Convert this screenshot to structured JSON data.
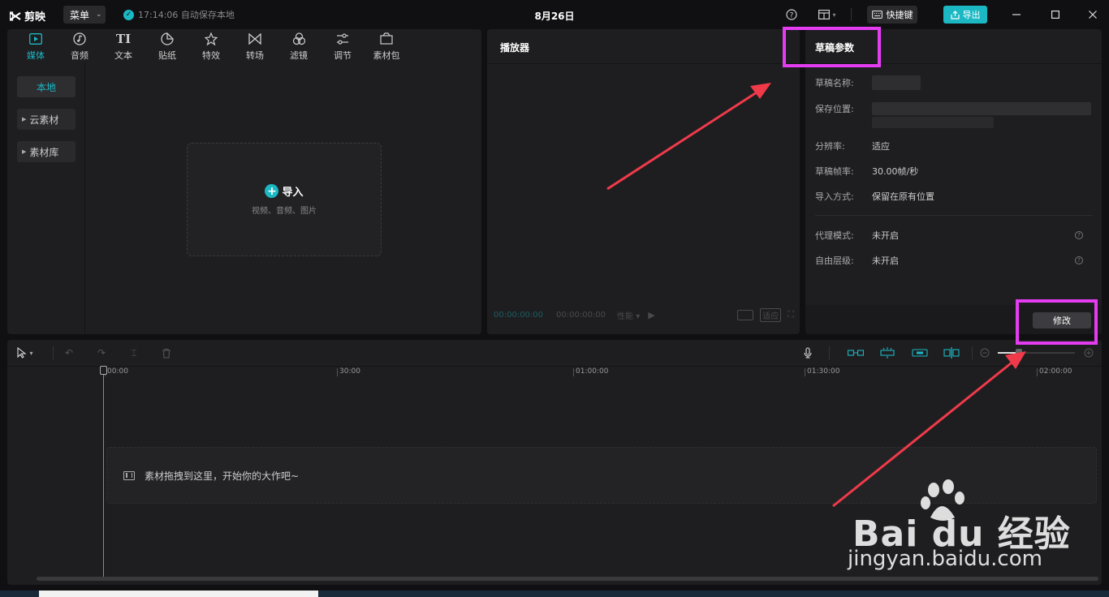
{
  "titlebar": {
    "app_name": "剪映",
    "menu_label": "菜单",
    "save_status": "17:14:06 自动保存本地",
    "project_title": "8月26日",
    "shortcut_label": "快捷键",
    "export_label": "导出"
  },
  "media_panel": {
    "tabs": [
      {
        "label": "媒体",
        "icon": "media-icon"
      },
      {
        "label": "音频",
        "icon": "audio-icon"
      },
      {
        "label": "文本",
        "icon": "text-icon"
      },
      {
        "label": "贴纸",
        "icon": "sticker-icon"
      },
      {
        "label": "特效",
        "icon": "effects-icon"
      },
      {
        "label": "转场",
        "icon": "transition-icon"
      },
      {
        "label": "滤镜",
        "icon": "filter-icon"
      },
      {
        "label": "调节",
        "icon": "adjust-icon"
      },
      {
        "label": "素材包",
        "icon": "package-icon"
      }
    ],
    "sidebar": [
      {
        "label": "本地"
      },
      {
        "label": "云素材"
      },
      {
        "label": "素材库"
      }
    ],
    "import": {
      "label": "导入",
      "hint": "视频、音频、图片"
    }
  },
  "player": {
    "title": "播放器",
    "timecode_current": "00:00:00:00",
    "timecode_total": "00:00:00:00",
    "quality_label": "性能",
    "ratio_label": "适应"
  },
  "draft": {
    "title": "草稿参数",
    "rows": [
      {
        "label": "草稿名称:",
        "value": ""
      },
      {
        "label": "保存位置:",
        "value": ""
      },
      {
        "label": "分辨率:",
        "value": "适应"
      },
      {
        "label": "草稿帧率:",
        "value": "30.00帧/秒"
      },
      {
        "label": "导入方式:",
        "value": "保留在原有位置"
      },
      {
        "label": "代理模式:",
        "value": "未开启"
      },
      {
        "label": "自由层级:",
        "value": "未开启"
      }
    ],
    "modify_label": "修改"
  },
  "timeline": {
    "ruler_ticks": [
      "00:00",
      "30:00",
      "01:00:00",
      "01:30:00",
      "02:00:00"
    ],
    "drop_hint": "素材拖拽到这里，开始你的大作吧~",
    "zoom_level": 0.27
  },
  "watermark": {
    "brand": "Bai du 经验",
    "url": "jingyan.baidu.com"
  },
  "colors": {
    "accent": "#1bb8c4",
    "highlight": "#e43cf0",
    "arrow": "#f03a4a"
  }
}
